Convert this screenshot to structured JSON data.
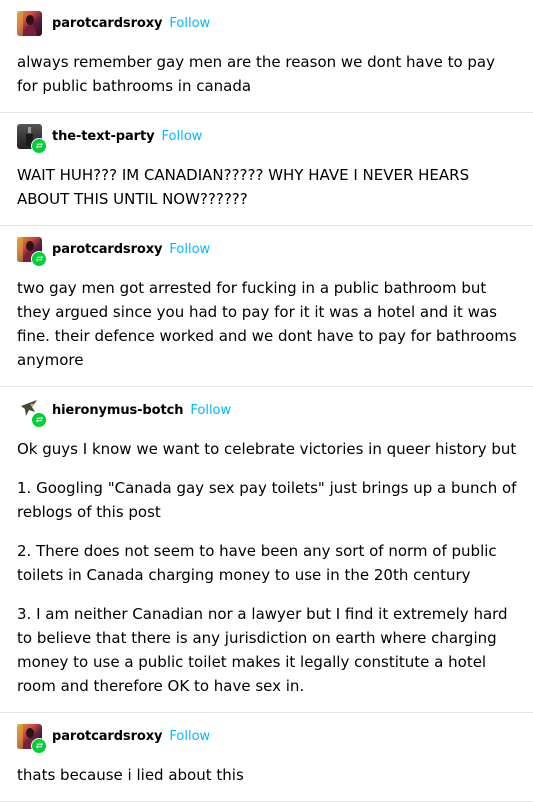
{
  "follow_label": "Follow",
  "posts": [
    {
      "username": "parotcardsroxy",
      "paragraphs": [
        "always remember gay men are the reason we dont have to pay for public bathrooms in canada"
      ]
    },
    {
      "username": "the-text-party",
      "paragraphs": [
        "WAIT HUH??? IM CANADIAN????? WHY HAVE I NEVER HEARS ABOUT THIS UNTIL NOW??????"
      ]
    },
    {
      "username": "parotcardsroxy",
      "paragraphs": [
        "two gay men got arrested for fucking in a public bathroom but they argued since you had to pay for it it was a hotel and it was fine. their defence worked and we dont have to pay for bathrooms anymore"
      ]
    },
    {
      "username": "hieronymus-botch",
      "paragraphs": [
        "Ok guys I know we want to celebrate victories in queer history but",
        "1. Googling \"Canada gay sex pay toilets\" just brings up a bunch of reblogs of this post",
        "2. There does not seem to have been any sort of norm of public toilets in Canada charging money to use in the 20th century",
        "3. I am neither Canadian nor a lawyer but I find it extremely hard to believe that there is any jurisdiction on earth where charging money to use a public toilet makes it legally constitute a hotel room and therefore OK to have sex in."
      ]
    },
    {
      "username": "parotcardsroxy",
      "paragraphs": [
        "thats because i lied about this"
      ]
    }
  ],
  "colors": {
    "follow": "#00b8ff",
    "reblog_badge": "#00cf35",
    "divider": "#e5e5e5"
  },
  "icons": {
    "reblog_badge": "reblog-icon"
  }
}
